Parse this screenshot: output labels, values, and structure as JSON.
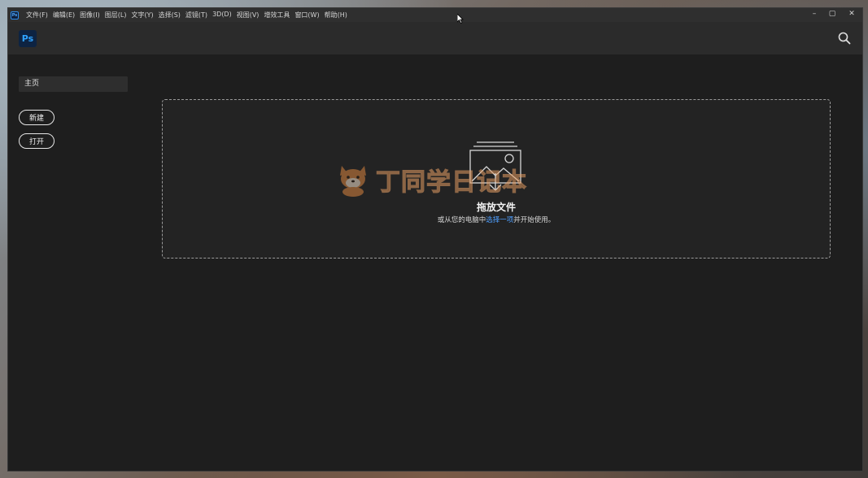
{
  "titlebar": {
    "app_badge": "Ps",
    "menu": [
      "文件(F)",
      "编辑(E)",
      "图像(I)",
      "图层(L)",
      "文字(Y)",
      "选择(S)",
      "滤镜(T)",
      "3D(D)",
      "视图(V)",
      "增效工具",
      "窗口(W)",
      "帮助(H)"
    ],
    "controls": {
      "minimize": "–",
      "maximize": "▢",
      "close": "✕"
    }
  },
  "appbar": {
    "logo": "Ps",
    "search_icon": "search-icon"
  },
  "sidebar": {
    "home_label": "主页",
    "new_label": "新建",
    "open_label": "打开"
  },
  "dropzone": {
    "icon": "image-drop-icon",
    "title": "拖放文件",
    "subtitle_prefix": "或从您的电脑中",
    "subtitle_link": "选择一项",
    "subtitle_suffix": "并开始使用。"
  },
  "watermark": {
    "text": "丁同学日记本"
  },
  "colors": {
    "accent_blue": "#4f9fff",
    "ps_brand": "#2fa3ff",
    "window_bg": "#1e1e1e"
  }
}
